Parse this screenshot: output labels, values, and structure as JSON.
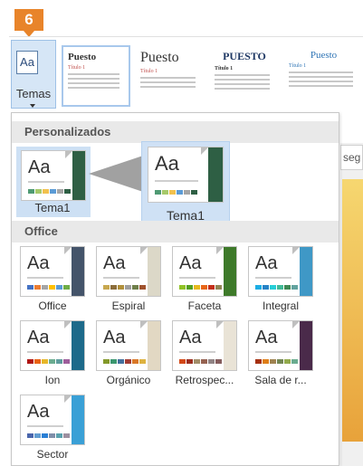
{
  "step_badge": "6",
  "ribbon": {
    "temas_label": "Temas",
    "style_sets": [
      {
        "title": "Puesto",
        "subtitle": "Título 1"
      },
      {
        "title": "Puesto",
        "subtitle": "Título 1"
      },
      {
        "title": "PUESTO",
        "subtitle": "Título 1"
      },
      {
        "title": "Puesto",
        "subtitle": "Título 1"
      }
    ]
  },
  "dropdown": {
    "custom_header": "Personalizados",
    "custom_themes": [
      {
        "label": "Tema1",
        "preview": "Aa"
      }
    ],
    "drag_preview": {
      "label": "Tema1",
      "preview": "Aa"
    },
    "office_header": "Office",
    "office_themes": [
      {
        "label": "Office",
        "preview": "Aa",
        "accent": "#44546a",
        "colors": [
          "#4472c4",
          "#ed7d31",
          "#a5a5a5",
          "#ffc000",
          "#5b9bd5",
          "#70ad47"
        ]
      },
      {
        "label": "Espiral",
        "preview": "Aa",
        "accent": "#dcd8c8",
        "colors": [
          "#c8a850",
          "#8c6e3c",
          "#b0903c",
          "#9e9e9e",
          "#6f7f4a",
          "#a0522d"
        ]
      },
      {
        "label": "Faceta",
        "preview": "Aa",
        "accent": "#3e7a2a",
        "colors": [
          "#90c226",
          "#54a021",
          "#e6b91e",
          "#e76618",
          "#c42f1a",
          "#918655"
        ]
      },
      {
        "label": "Integral",
        "preview": "Aa",
        "accent": "#3f98c6",
        "colors": [
          "#1cade4",
          "#2683c6",
          "#27ced7",
          "#42ba97",
          "#3e8853",
          "#62a39f"
        ]
      },
      {
        "label": "Ion",
        "preview": "Aa",
        "accent": "#1d6a8a",
        "colors": [
          "#b01513",
          "#ea6312",
          "#e6b729",
          "#6aac90",
          "#5f9c9d",
          "#9e5e9b"
        ]
      },
      {
        "label": "Orgánico",
        "preview": "Aa",
        "accent": "#e2d8c3",
        "colors": [
          "#83992a",
          "#3c9770",
          "#44709d",
          "#a23c33",
          "#d97828",
          "#deb340"
        ]
      },
      {
        "label": "Retrospec...",
        "preview": "Aa",
        "accent": "#e9e3d6",
        "colors": [
          "#d34817",
          "#9b2d1f",
          "#a28e6a",
          "#956251",
          "#918485",
          "#855d5d"
        ]
      },
      {
        "label": "Sala de r...",
        "preview": "Aa",
        "accent": "#4a2a4a",
        "colors": [
          "#a53010",
          "#de7e18",
          "#9f8351",
          "#728653",
          "#92aa4c",
          "#6aac90"
        ]
      },
      {
        "label": "Sector",
        "preview": "Aa",
        "accent": "#3aa0d6",
        "colors": [
          "#4a66ac",
          "#629dd1",
          "#297fd5",
          "#7f8fa9",
          "#5aa2ae",
          "#9d90a0"
        ]
      }
    ]
  },
  "document_edge": {
    "visible_text": "seg"
  }
}
